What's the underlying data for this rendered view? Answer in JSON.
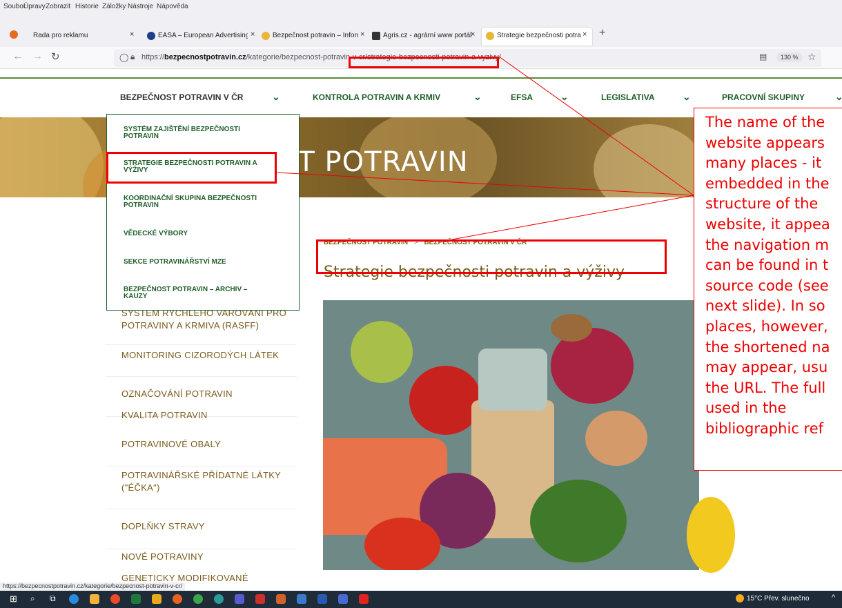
{
  "browser": {
    "menu": [
      "Soubor",
      "Úpravy",
      "Zobrazit",
      "Historie",
      "Záložky",
      "Nástroje",
      "Nápověda"
    ],
    "tabs": [
      {
        "title": "Rada pro reklamu"
      },
      {
        "title": "EASA – European Advertising St"
      },
      {
        "title": "Bezpečnost potravin – Informa"
      },
      {
        "title": "Agris.cz - agrární www portál"
      },
      {
        "title": "Strategie bezpečnosti potravin a"
      }
    ],
    "url_prefix": "https://",
    "url_host": "bezpecnostpotravin.cz",
    "url_path": "/kategorie/bezpecnost-potravin-v-cr/strategie-bezpecnosti-potravin-a-vyzivy/",
    "zoom": "130 %",
    "status_url": "https://bezpecnostpotravin.cz/kategorie/bezpecnost-potravin-v-cr/"
  },
  "nav": {
    "items": [
      "BEZPEČNOST POTRAVIN V ČR",
      "KONTROLA POTRAVIN A KRMIV",
      "EFSA",
      "LEGISLATIVA",
      "PRACOVNÍ SKUPINY"
    ]
  },
  "hero": {
    "title": "ST POTRAVIN"
  },
  "dropdown": {
    "items": [
      [
        "SYSTÉM ZAJIŠTĚNÍ BEZPEČNOSTI",
        "POTRAVIN"
      ],
      [
        "STRATEGIE BEZPEČNOSTI POTRAVIN A",
        "VÝŽIVY"
      ],
      [
        "KOORDINAČNÍ SKUPINA BEZPEČNOSTI",
        "POTRAVIN"
      ],
      [
        "VĚDECKÉ VÝBORY"
      ],
      [
        "SEKCE POTRAVINÁŘSTVÍ MZE"
      ],
      [
        "BEZPEČNOST POTRAVIN – ARCHIV –",
        "KAUZY"
      ]
    ]
  },
  "sidebar": {
    "items": [
      [
        "SYSTÉM RYCHLÉHO VAROVÁNÍ PRO",
        "POTRAVINY A KRMIVA (RASFF)"
      ],
      [
        "MONITORING CIZORODÝCH LÁTEK"
      ],
      [
        "OZNAČOVÁNÍ POTRAVIN"
      ],
      [
        "KVALITA POTRAVIN"
      ],
      [
        "POTRAVINOVÉ OBALY"
      ],
      [
        "POTRAVINÁŘSKÉ PŘÍDATNÉ LÁTKY",
        "(\"ÉČKA\")"
      ],
      [
        "DOPLŇKY STRAVY"
      ],
      [
        "NOVÉ POTRAVINY"
      ],
      [
        "GENETICKY MODIFIKOVANÉ"
      ]
    ]
  },
  "content": {
    "breadcrumb": [
      "BEZPEČNOST POTRAVIN",
      ">",
      "BEZPEČNOST POTRAVIN V ČR"
    ],
    "title": "Strategie bezpečnosti potravin a výživy"
  },
  "callout": {
    "lines": [
      "The name of the",
      "website appears",
      "many places - it",
      "embedded in the",
      "structure of the",
      "website, it appea",
      "the navigation m",
      "can be found in t",
      "source code (see",
      "next slide). In so",
      "places, however,",
      "the shortened na",
      "may appear, usu",
      "the URL. The full",
      "used in the",
      "bibliographic ref"
    ]
  },
  "taskbar": {
    "weather": "15°C  Přev. slunečno"
  },
  "colors": {
    "accent_green": "#1f5e2a",
    "brown_text": "#7a5a1a",
    "annotation_red": "#e00000"
  }
}
